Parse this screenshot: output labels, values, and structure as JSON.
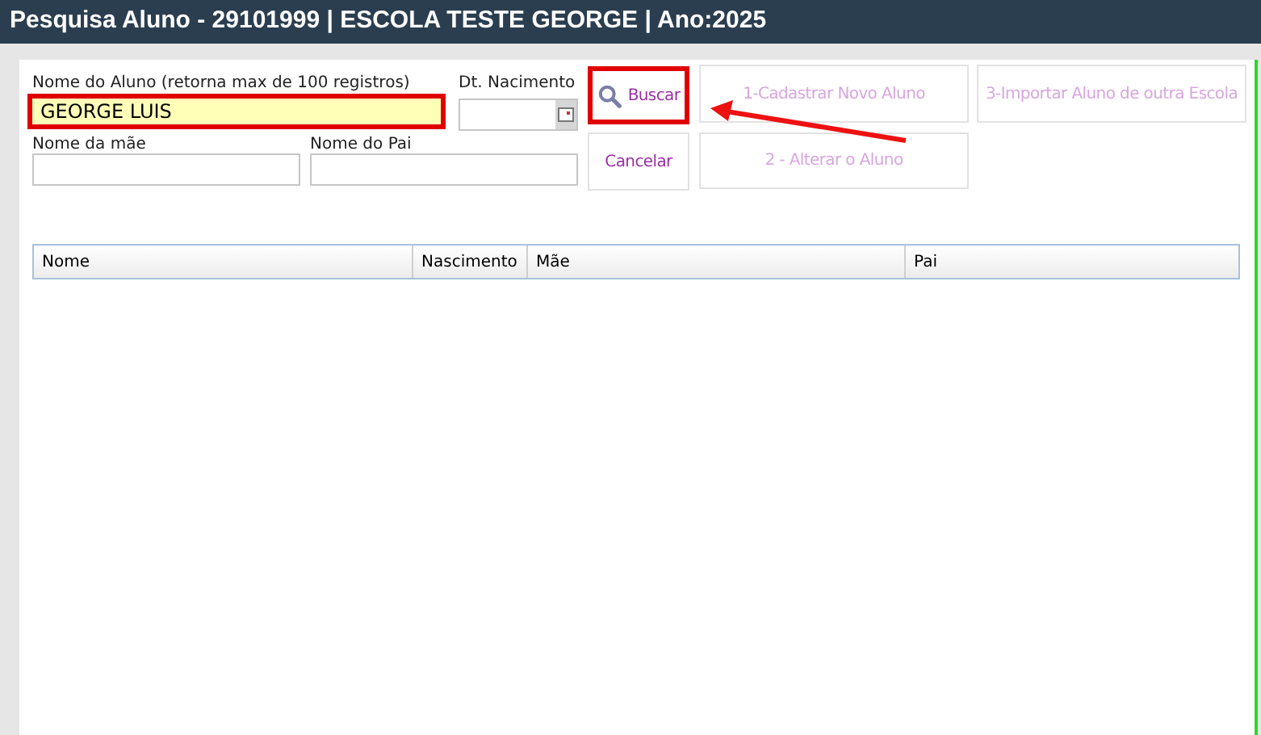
{
  "window": {
    "title": "Pesquisa Aluno - 29101999 | ESCOLA TESTE GEORGE | Ano:2025"
  },
  "fields": {
    "student_name": {
      "label": "Nome do Aluno (retorna max de 100 registros)",
      "value": "GEORGE LUIS",
      "highlighted": true
    },
    "birth_date": {
      "label": "Dt. Nacimento"
    },
    "mother_name": {
      "label": "Nome da mãe"
    },
    "father_name": {
      "label": "Nome do Pai"
    }
  },
  "buttons": [
    {
      "label": "Buscar",
      "disabled": false,
      "highlighted": true
    },
    {
      "label": "1-Cadastrar Novo Aluno",
      "disabled": true,
      "highlighted": false
    },
    {
      "label": "3-Importar Aluno de outra Escola",
      "disabled": true,
      "highlighted": false
    },
    {
      "label": "Cancelar",
      "disabled": false,
      "highlighted": false
    },
    {
      "label": "2 - Alterar o Aluno",
      "disabled": true,
      "highlighted": false
    }
  ],
  "table": {
    "columns": [
      "Nome",
      "Nascimento",
      "Mãe",
      "Pai"
    ]
  }
}
